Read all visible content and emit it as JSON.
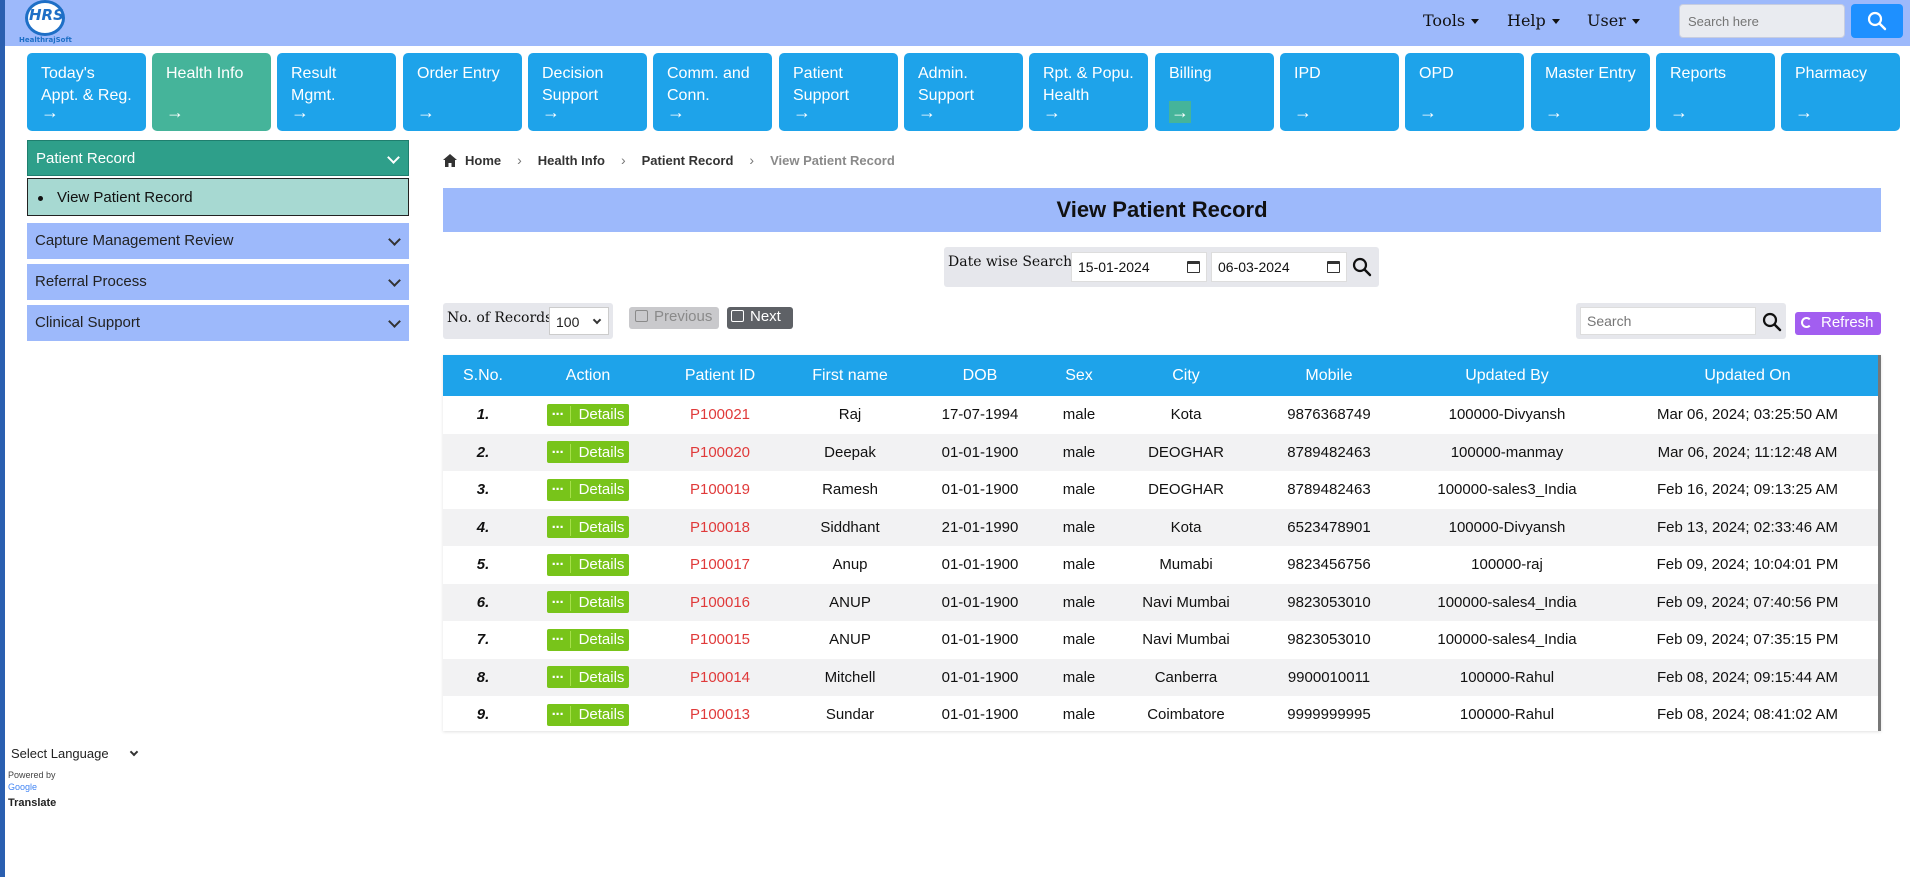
{
  "header": {
    "logo_text": "HealthrajSoft",
    "logo_mark": "HRS",
    "menu": [
      "Tools",
      "Help",
      "User"
    ],
    "search_placeholder": "Search here"
  },
  "tiles": [
    {
      "line1": "Today's",
      "line2": "Appt. & Reg."
    },
    {
      "line1": "Health Info",
      "line2": ""
    },
    {
      "line1": "Result Mgmt.",
      "line2": ""
    },
    {
      "line1": "Order Entry",
      "line2": ""
    },
    {
      "line1": "Decision",
      "line2": "Support"
    },
    {
      "line1": "Comm. and",
      "line2": "Conn."
    },
    {
      "line1": "Patient",
      "line2": "Support"
    },
    {
      "line1": "Admin.",
      "line2": "Support"
    },
    {
      "line1": "Rpt. & Popu.",
      "line2": "Health"
    },
    {
      "line1": "Billing",
      "line2": ""
    },
    {
      "line1": "IPD",
      "line2": ""
    },
    {
      "line1": "OPD",
      "line2": ""
    },
    {
      "line1": "Master Entry",
      "line2": ""
    },
    {
      "line1": "Reports",
      "line2": ""
    },
    {
      "line1": "Pharmacy",
      "line2": ""
    }
  ],
  "tile_arrow": "→",
  "sidebar": {
    "active_section": "Patient Record",
    "active_sub": "View Patient Record",
    "sections": [
      "Capture Management Review",
      "Referral Process",
      "Clinical Support"
    ]
  },
  "language": {
    "select": "Select Language",
    "powered": "Powered by",
    "google": "Google",
    "translate": "Translate"
  },
  "breadcrumb": [
    "Home",
    "Health Info",
    "Patient Record",
    "View Patient Record"
  ],
  "page_title": "View Patient Record",
  "date_search": {
    "label": "Date wise Search",
    "from": "15-01-2024",
    "to": "06-03-2024"
  },
  "records": {
    "label": "No. of Records",
    "value": "100",
    "prev": "Previous",
    "next": "Next"
  },
  "table_search_placeholder": "Search",
  "refresh_label": "Refresh",
  "table": {
    "headers": [
      "S.No.",
      "Action",
      "Patient ID",
      "First name",
      "DOB",
      "Sex",
      "City",
      "Mobile",
      "Updated By",
      "Updated On"
    ],
    "action_label": "Details",
    "rows": [
      [
        "1.",
        "P100021",
        "Raj",
        "17-07-1994",
        "male",
        "Kota",
        "9876368749",
        "100000-Divyansh",
        "Mar 06, 2024; 03:25:50 AM"
      ],
      [
        "2.",
        "P100020",
        "Deepak",
        "01-01-1900",
        "male",
        "DEOGHAR",
        "8789482463",
        "100000-manmay",
        "Mar 06, 2024; 11:12:48 AM"
      ],
      [
        "3.",
        "P100019",
        "Ramesh",
        "01-01-1900",
        "male",
        "DEOGHAR",
        "8789482463",
        "100000-sales3_India",
        "Feb 16, 2024; 09:13:25 AM"
      ],
      [
        "4.",
        "P100018",
        "Siddhant",
        "21-01-1990",
        "male",
        "Kota",
        "6523478901",
        "100000-Divyansh",
        "Feb 13, 2024; 02:33:46 AM"
      ],
      [
        "5.",
        "P100017",
        "Anup",
        "01-01-1900",
        "male",
        "Mumabi",
        "9823456756",
        "100000-raj",
        "Feb 09, 2024; 10:04:01 PM"
      ],
      [
        "6.",
        "P100016",
        "ANUP",
        "01-01-1900",
        "male",
        "Navi Mumbai",
        "9823053010",
        "100000-sales4_India",
        "Feb 09, 2024; 07:40:56 PM"
      ],
      [
        "7.",
        "P100015",
        "ANUP",
        "01-01-1900",
        "male",
        "Navi Mumbai",
        "9823053010",
        "100000-sales4_India",
        "Feb 09, 2024; 07:35:15 PM"
      ],
      [
        "8.",
        "P100014",
        "Mitchell",
        "01-01-1900",
        "male",
        "Canberra",
        "9900010011",
        "100000-Rahul",
        "Feb 08, 2024; 09:15:44 AM"
      ],
      [
        "9.",
        "P100013",
        "Sundar",
        "01-01-1900",
        "male",
        "Coimbatore",
        "9999999995",
        "100000-Rahul",
        "Feb 08, 2024; 08:41:02 AM"
      ]
    ]
  },
  "colors": {
    "header_bg": "#9db9fb",
    "tile_blue": "#1ea3ea",
    "tile_active": "#45b49a",
    "details_green": "#78c41a",
    "patient_id_red": "#e03a3a",
    "refresh_purple": "#a25ef0"
  }
}
